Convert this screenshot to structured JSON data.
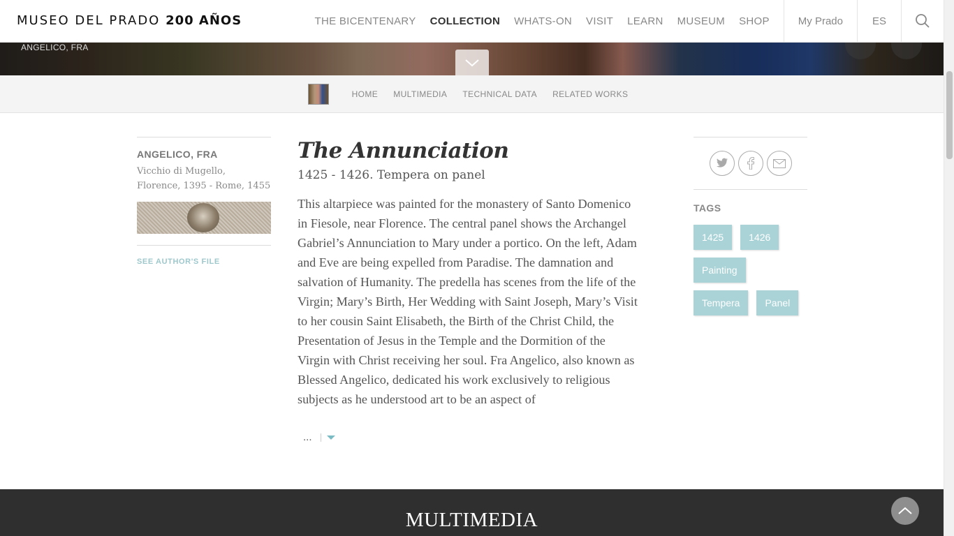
{
  "header": {
    "logo_text": "MUSEO DEL PRADO",
    "logo_bold": "200 AÑOS",
    "nav": [
      "THE BICENTENARY",
      "COLLECTION",
      "WHATS-ON",
      "VISIT",
      "LEARN",
      "MUSEUM",
      "SHOP"
    ],
    "active_nav": "COLLECTION",
    "my_prado": "My Prado",
    "lang": "ES",
    "search_icon": "search-icon"
  },
  "hero": {
    "artist": "ANGELICO, FRA",
    "toggle_icon": "chevron-down-icon"
  },
  "subnav": {
    "items": [
      "HOME",
      "MULTIMEDIA",
      "TECHNICAL DATA",
      "RELATED WORKS"
    ]
  },
  "author": {
    "name": "ANGELICO, FRA",
    "info": "Vicchio di Mugello, Florence, 1395 - Rome, 1455",
    "link": "SEE AUTHOR'S FILE"
  },
  "artwork": {
    "title": "The Annunciation",
    "subtitle": "1425 - 1426. Tempera on panel",
    "description": "This altarpiece was painted for the monastery of Santo Domenico in Fiesole, near Florence. The central panel shows the Archangel Gabriel’s Annunciation to Mary under a portico. On the left, Adam and Eve are being expelled from Paradise. The damnation and salvation of Humanity. The predella has scenes from the life of the Virgin; Mary’s Birth, Her Wedding with Saint Joseph, Mary’s Visit to her cousin Saint Elisabeth, the Birth of the Christ Child, the Presentation of Jesus in the Temple and the Dormition of the Virgin with Christ receiving her soul. Fra Angelico, also known as Blessed Angelico, dedicated his work exclusively to religious subjects as he understood art to be an aspect of",
    "more": "..."
  },
  "share": {
    "icons": [
      "twitter-icon",
      "facebook-icon",
      "email-icon"
    ]
  },
  "tags": {
    "title": "TAGS",
    "items": [
      "1425",
      "1426",
      "Painting",
      "Tempera",
      "Panel"
    ]
  },
  "multimedia": {
    "title": "MULTIMEDIA"
  },
  "colors": {
    "tag_bg": "#a9d3d7",
    "link": "#9ec8cc",
    "band": "#2f2f2f"
  }
}
